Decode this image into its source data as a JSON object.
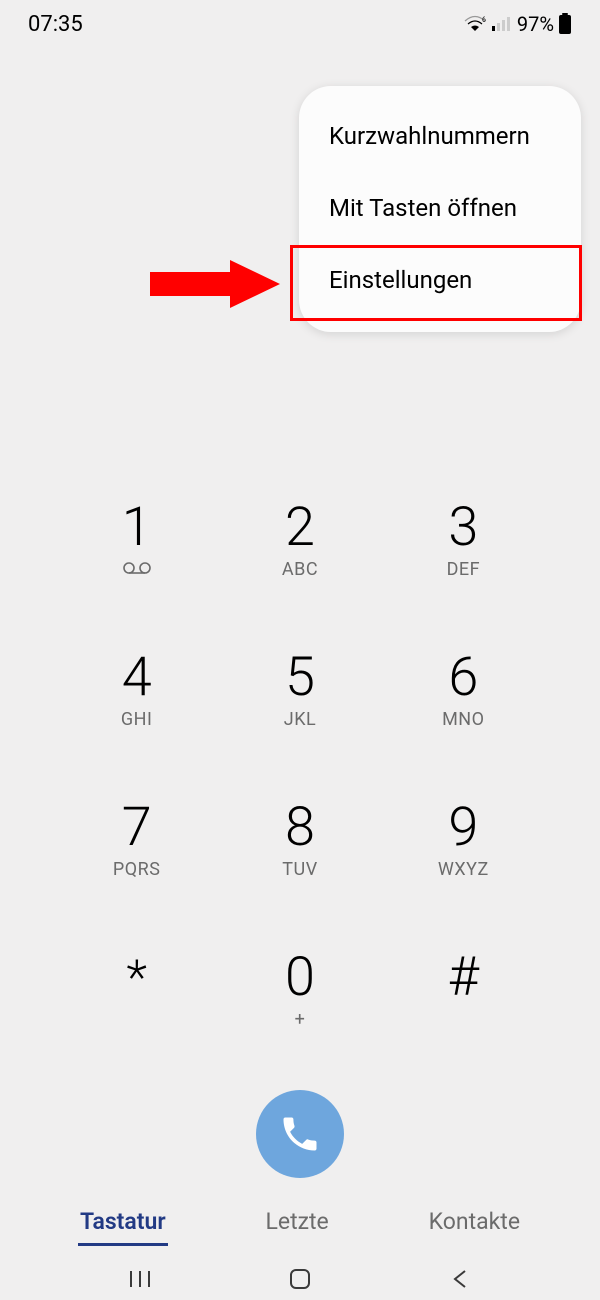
{
  "status": {
    "time": "07:35",
    "battery": "97%"
  },
  "popup": {
    "items": [
      "Kurzwahlnummern",
      "Mit Tasten öffnen",
      "Einstellungen"
    ]
  },
  "keypad": {
    "keys": [
      {
        "digit": "1",
        "letters": ""
      },
      {
        "digit": "2",
        "letters": "ABC"
      },
      {
        "digit": "3",
        "letters": "DEF"
      },
      {
        "digit": "4",
        "letters": "GHI"
      },
      {
        "digit": "5",
        "letters": "JKL"
      },
      {
        "digit": "6",
        "letters": "MNO"
      },
      {
        "digit": "7",
        "letters": "PQRS"
      },
      {
        "digit": "8",
        "letters": "TUV"
      },
      {
        "digit": "9",
        "letters": "WXYZ"
      },
      {
        "digit": "*",
        "letters": ""
      },
      {
        "digit": "0",
        "letters": "+"
      },
      {
        "digit": "#",
        "letters": ""
      }
    ]
  },
  "tabs": {
    "items": [
      "Tastatur",
      "Letzte",
      "Kontakte"
    ],
    "activeIndex": 0
  }
}
